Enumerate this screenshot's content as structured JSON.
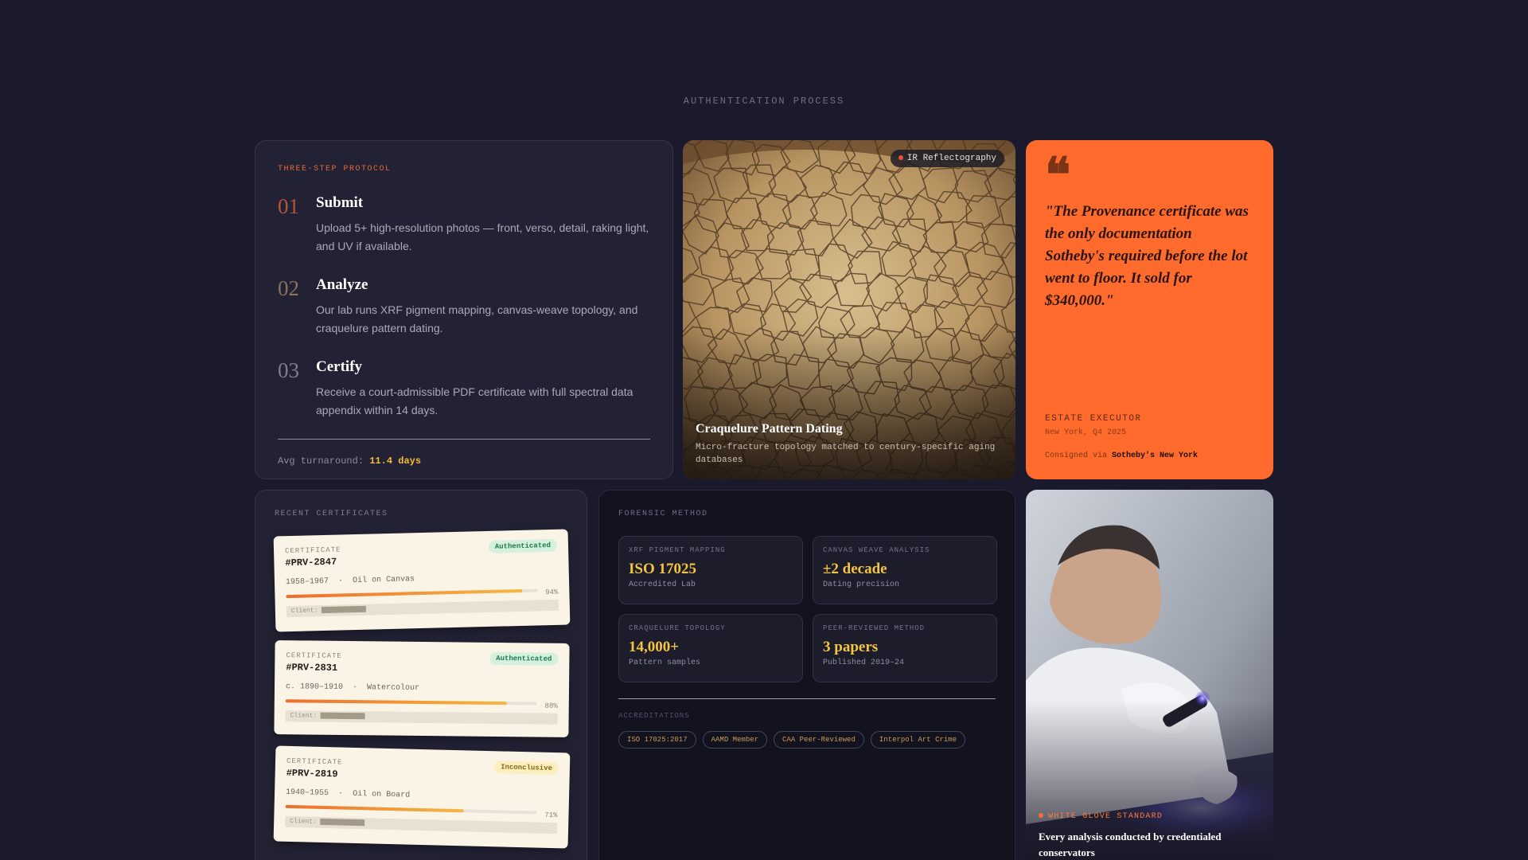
{
  "section": {
    "label": "AUTHENTICATION PROCESS"
  },
  "protocol": {
    "eyebrow": "THREE-STEP PROTOCOL",
    "steps": [
      {
        "num": "01",
        "title": "Submit",
        "desc": "Upload 5+ high-resolution photos — front, verso, detail, raking light, and UV if available."
      },
      {
        "num": "02",
        "title": "Analyze",
        "desc": "Our lab runs XRF pigment mapping, canvas-weave topology, and craquelure pattern dating."
      },
      {
        "num": "03",
        "title": "Certify",
        "desc": "Receive a court-admissible PDF certificate with full spectral data appendix within 14 days."
      }
    ],
    "turnaround_label": "Avg turnaround:",
    "turnaround_value": "11.4 days"
  },
  "craquelure": {
    "chip": "IR Reflectography",
    "title": "Craquelure Pattern Dating",
    "desc": "Micro-fracture topology matched to century-specific aging databases"
  },
  "quote": {
    "mark": "❝",
    "text": "\"The Provenance certificate was the only documentation Sotheby's required before the lot went to floor. It sold for $340,000.\"",
    "role": "ESTATE EXECUTOR",
    "location": "New York, Q4 2025",
    "via_label": "Consigned via",
    "via_value": "Sotheby's New York"
  },
  "certificates": {
    "label": "RECENT CERTIFICATES",
    "items": [
      {
        "kicker": "CERTIFICATE",
        "id": "#PRV-2847",
        "status": "Authenticated",
        "status_type": "ok",
        "date": "1958–1967",
        "sep": "·",
        "medium": "Oil on Canvas",
        "confidence": 94,
        "pct": "94%",
        "client": "Client:"
      },
      {
        "kicker": "CERTIFICATE",
        "id": "#PRV-2831",
        "status": "Authenticated",
        "status_type": "ok",
        "date": "c. 1890–1910",
        "sep": "·",
        "medium": "Watercolour",
        "confidence": 88,
        "pct": "88%",
        "client": "Client:"
      },
      {
        "kicker": "CERTIFICATE",
        "id": "#PRV-2819",
        "status": "Inconclusive",
        "status_type": "maybe",
        "date": "1940–1955",
        "sep": "·",
        "medium": "Oil on Board",
        "confidence": 71,
        "pct": "71%",
        "client": "Client:"
      }
    ]
  },
  "forensic": {
    "label": "FORENSIC METHOD",
    "metrics": [
      {
        "key": "XRF PIGMENT MAPPING",
        "value": "ISO 17025",
        "sub": "Accredited Lab"
      },
      {
        "key": "CANVAS WEAVE ANALYSIS",
        "value": "±2 decade",
        "sub": "Dating precision"
      },
      {
        "key": "CRAQUELURE TOPOLOGY",
        "value": "14,000+",
        "sub": "Pattern samples"
      },
      {
        "key": "PEER-REVIEWED METHOD",
        "value": "3 papers",
        "sub": "Published 2019–24"
      }
    ],
    "accreditations_label": "ACCREDITATIONS",
    "accreditations": [
      "ISO 17025:2017",
      "AAMD Member",
      "CAA Peer-Reviewed",
      "Interpol Art Crime"
    ]
  },
  "conservator": {
    "label": "WHITE GLOVE STANDARD",
    "title": "Every analysis conducted by credentialed conservators"
  },
  "colors": {
    "accent": "#ff6b2c",
    "gold": "#f4c542",
    "bg": "#1a1a2c"
  }
}
